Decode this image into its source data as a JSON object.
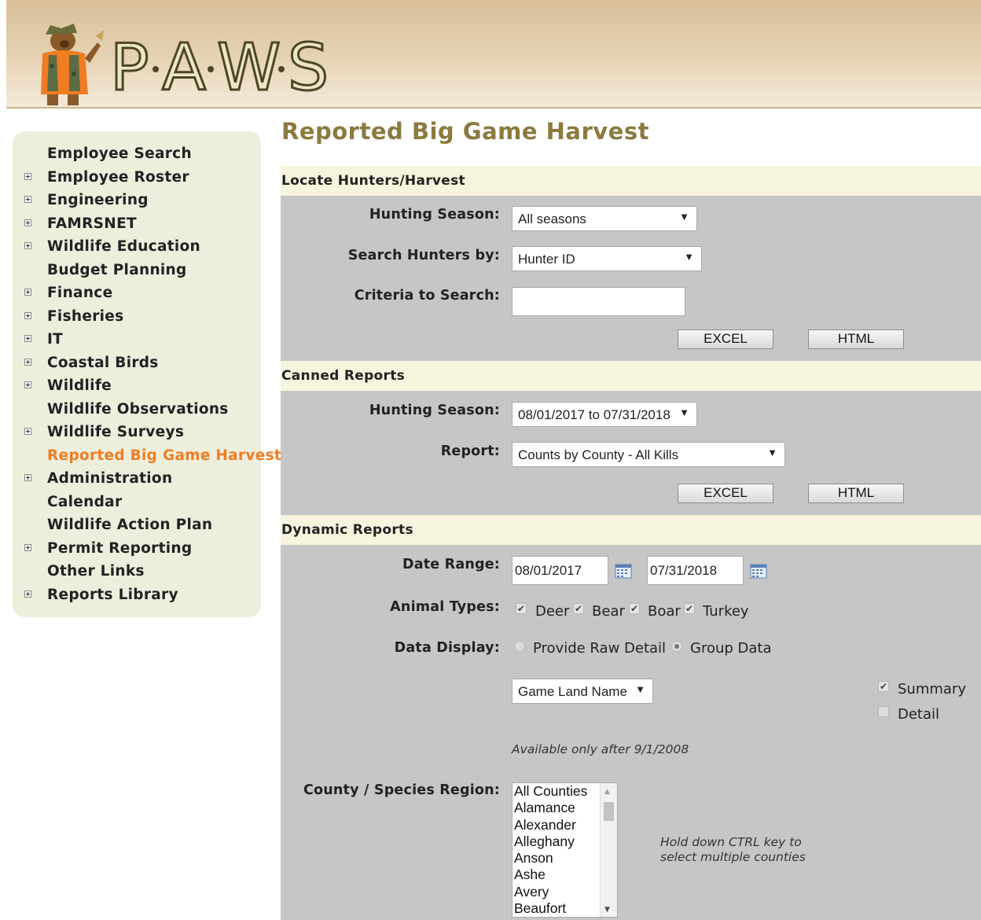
{
  "header": {
    "logo_text": "P·A·W·S"
  },
  "sidebar": {
    "items": [
      {
        "label": "Employee Search",
        "expandable": false,
        "active": false
      },
      {
        "label": "Employee Roster",
        "expandable": true,
        "active": false
      },
      {
        "label": "Engineering",
        "expandable": true,
        "active": false
      },
      {
        "label": "FAMRSNET",
        "expandable": true,
        "active": false
      },
      {
        "label": "Wildlife Education",
        "expandable": true,
        "active": false
      },
      {
        "label": "Budget Planning",
        "expandable": false,
        "active": false
      },
      {
        "label": "Finance",
        "expandable": true,
        "active": false
      },
      {
        "label": "Fisheries",
        "expandable": true,
        "active": false
      },
      {
        "label": "IT",
        "expandable": true,
        "active": false
      },
      {
        "label": "Coastal Birds",
        "expandable": true,
        "active": false
      },
      {
        "label": "Wildlife",
        "expandable": true,
        "active": false
      },
      {
        "label": "Wildlife Observations",
        "expandable": false,
        "active": false
      },
      {
        "label": "Wildlife Surveys",
        "expandable": true,
        "active": false
      },
      {
        "label": "Reported Big Game Harvest",
        "expandable": false,
        "active": true
      },
      {
        "label": "Administration",
        "expandable": true,
        "active": false
      },
      {
        "label": "Calendar",
        "expandable": false,
        "active": false
      },
      {
        "label": "Wildlife Action Plan",
        "expandable": false,
        "active": false
      },
      {
        "label": "Permit Reporting",
        "expandable": true,
        "active": false
      },
      {
        "label": "Other Links",
        "expandable": false,
        "active": false
      },
      {
        "label": "Reports Library",
        "expandable": true,
        "active": false
      }
    ]
  },
  "page": {
    "title": "Reported Big Game Harvest"
  },
  "locate": {
    "heading": "Locate Hunters/Harvest",
    "season_label": "Hunting Season:",
    "season_value": "All seasons",
    "search_by_label": "Search Hunters by:",
    "search_by_value": "Hunter ID",
    "criteria_label": "Criteria to Search:",
    "criteria_value": "",
    "excel_label": "EXCEL",
    "html_label": "HTML"
  },
  "canned": {
    "heading": "Canned Reports",
    "season_label": "Hunting Season:",
    "season_value": "08/01/2017 to 07/31/2018",
    "report_label": "Report:",
    "report_value": "Counts by County - All Kills",
    "excel_label": "EXCEL",
    "html_label": "HTML"
  },
  "dynamic": {
    "heading": "Dynamic Reports",
    "date_range_label": "Date Range:",
    "date_from": "08/01/2017",
    "date_to": "07/31/2018",
    "animal_types_label": "Animal Types:",
    "animals": [
      {
        "label": "Deer",
        "checked": true
      },
      {
        "label": "Bear",
        "checked": true
      },
      {
        "label": "Boar",
        "checked": true
      },
      {
        "label": "Turkey",
        "checked": true
      }
    ],
    "data_display_label": "Data Display:",
    "raw_detail_label": "Provide Raw Detail",
    "raw_detail_selected": false,
    "group_data_label": "Group Data",
    "group_data_selected": true,
    "group_by_value": "Game Land Name",
    "summary_label": "Summary",
    "summary_checked": true,
    "detail_label": "Detail",
    "detail_checked": false,
    "availability_note": "Available only after 9/1/2008",
    "county_label": "County / Species Region:",
    "counties": [
      "All Counties",
      "Alamance",
      "Alexander",
      "Alleghany",
      "Anson",
      "Ashe",
      "Avery",
      "Beaufort"
    ],
    "ctrl_note_line1": "Hold down CTRL key to",
    "ctrl_note_line2": "select multiple counties"
  }
}
